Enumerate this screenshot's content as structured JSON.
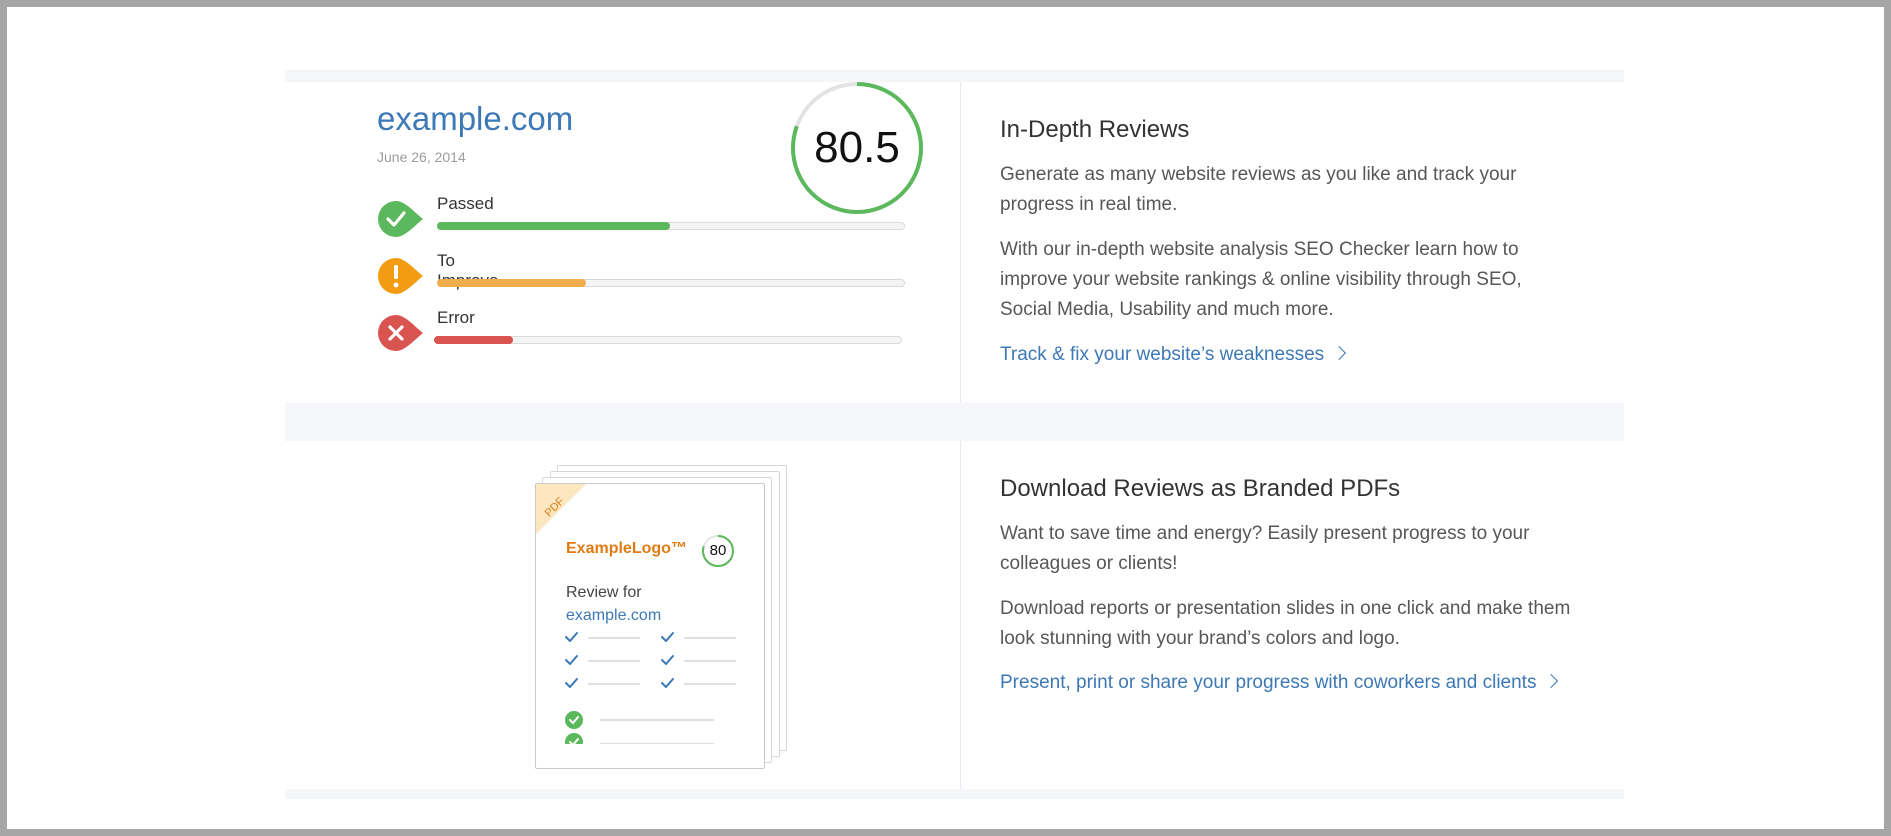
{
  "review_card": {
    "site": "example.com",
    "date": "June 26, 2014",
    "score": "80.5",
    "score_fraction": 0.805,
    "statuses": [
      {
        "label": "Passed",
        "icon": "check-icon",
        "color": "#5cb85c",
        "fraction": 0.5
      },
      {
        "label": "To Improve",
        "icon": "exclamation-icon",
        "color": "#f0ad4e",
        "fraction": 0.32
      },
      {
        "label": "Error",
        "icon": "x-icon",
        "color": "#d9534f",
        "fraction": 0.17
      }
    ]
  },
  "feature_reviews": {
    "heading": "In-Depth Reviews",
    "para1": "Generate as many website reviews as you like and track your progress in real time.",
    "para2": "With our in-depth website analysis SEO Checker learn how to improve your website rankings & online visibility through SEO, Social Media, Usability and much more.",
    "cta": "Track & fix your website’s weaknesses"
  },
  "feature_pdfs": {
    "heading": "Download Reviews as Branded PDFs",
    "para1": "Want to save time and energy?  Easily present progress to your colleagues or clients!",
    "para2": "Download reports or presentation slides in one click and make them look stunning with your brand’s colors and logo.",
    "cta": "Present, print or share your progress with coworkers and clients"
  },
  "pdf_preview": {
    "corner_label": "PDF",
    "logo": "ExampleLogo™",
    "score": "80",
    "review_for": "Review for",
    "site": "example.com"
  },
  "colors": {
    "accent": "#3d78b7",
    "passed": "#5cb85c",
    "improve": "#f0ad4e",
    "error": "#d9534f",
    "pdf_logo": "#e07c12"
  }
}
